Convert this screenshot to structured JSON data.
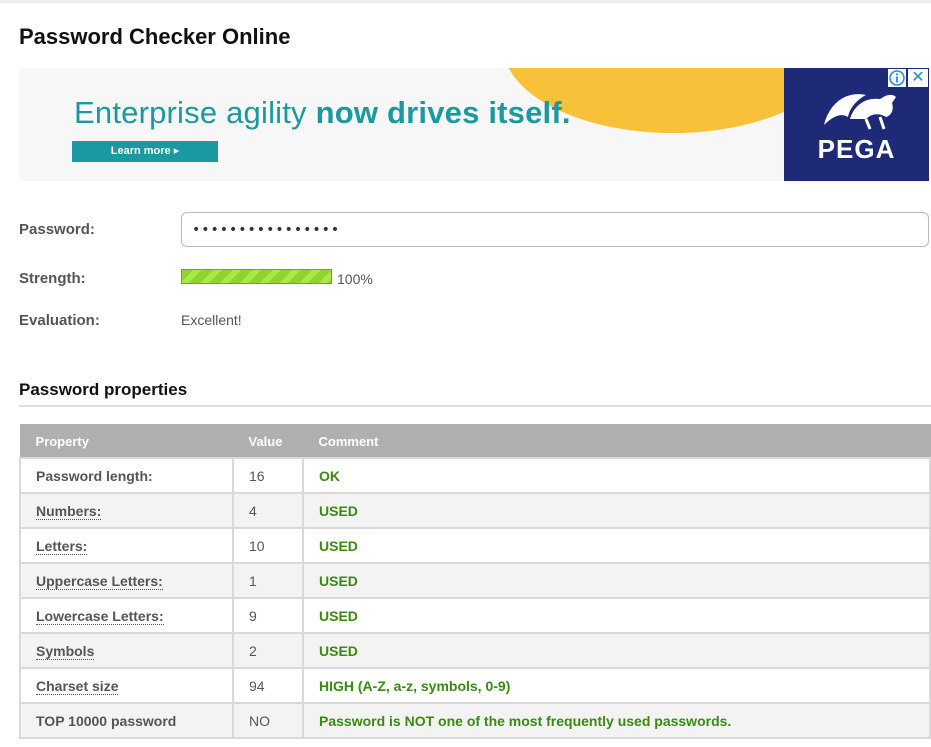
{
  "page": {
    "title": "Password Checker Online"
  },
  "ad": {
    "headline_regular": "Enterprise agility ",
    "headline_bold": "now drives itself.",
    "cta_label": "Learn more ▸",
    "brand": "PEGA",
    "info_icon": "info-icon",
    "close_icon": "close-icon",
    "close_glyph": "✕",
    "colors": {
      "teal": "#1a9aa0",
      "sun": "#f8c13a",
      "navy": "#1e2a78"
    }
  },
  "form": {
    "password_label": "Password:",
    "password_value": "••••••••••••••••",
    "strength_label": "Strength:",
    "strength_percent": 100,
    "strength_text": "100%",
    "evaluation_label": "Evaluation:",
    "evaluation_value": "Excellent!"
  },
  "properties": {
    "title": "Password properties",
    "headers": [
      "Property",
      "Value",
      "Comment"
    ],
    "rows": [
      {
        "property": "Password length:",
        "value": "16",
        "comment": "OK",
        "dotted": false
      },
      {
        "property": "Numbers:",
        "value": "4",
        "comment": "USED",
        "dotted": true
      },
      {
        "property": "Letters:",
        "value": "10",
        "comment": "USED",
        "dotted": true
      },
      {
        "property": "Uppercase Letters:",
        "value": "1",
        "comment": "USED",
        "dotted": true
      },
      {
        "property": "Lowercase Letters:",
        "value": "9",
        "comment": "USED",
        "dotted": true
      },
      {
        "property": "Symbols",
        "value": "2",
        "comment": "USED",
        "dotted": true
      },
      {
        "property": "Charset size",
        "value": "94",
        "comment": "HIGH (A-Z, a-z, symbols, 0-9)",
        "dotted": true
      },
      {
        "property": "TOP 10000 password",
        "value": "NO",
        "comment": "Password is NOT one of the most frequently used passwords.",
        "dotted": false
      }
    ],
    "comment_color": "#3a8a10"
  }
}
